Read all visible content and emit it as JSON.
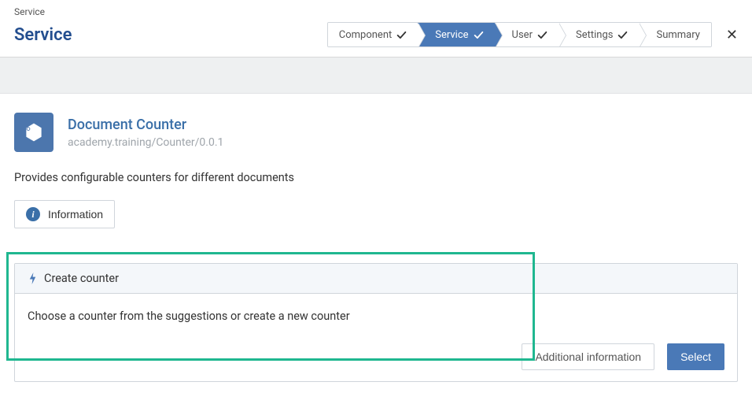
{
  "breadcrumb": "Service",
  "page_title": "Service",
  "wizard": {
    "steps": [
      {
        "label": "Component",
        "done": true,
        "active": false
      },
      {
        "label": "Service",
        "done": true,
        "active": true
      },
      {
        "label": "User",
        "done": true,
        "active": false
      },
      {
        "label": "Settings",
        "done": true,
        "active": false
      },
      {
        "label": "Summary",
        "done": false,
        "active": false
      }
    ]
  },
  "service": {
    "title": "Document Counter",
    "path": "academy.training/Counter/0.0.1",
    "description": "Provides configurable counters for different documents",
    "info_button": "Information"
  },
  "card": {
    "header": "Create counter",
    "body": "Choose a counter from the suggestions or create a new counter",
    "additional_btn": "Additional information",
    "select_btn": "Select"
  }
}
